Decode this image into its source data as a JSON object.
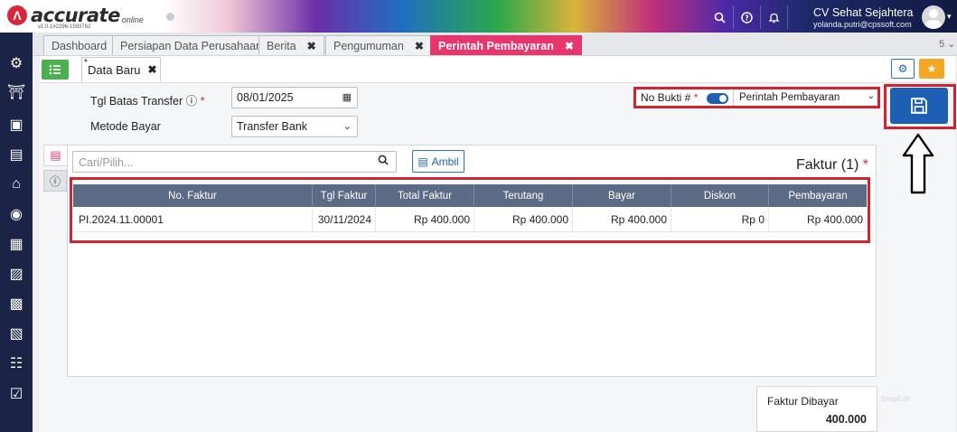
{
  "brand": {
    "name": "accurate",
    "cloud_label": "online",
    "version": "v1.0.1#2296-1593762"
  },
  "header": {
    "icons": [
      "search-icon",
      "help-icon",
      "bell-icon"
    ],
    "company_name": "CV Sehat Sejahtera",
    "user_email": "yolanda.putri@cpssoft.com"
  },
  "sidebar": {
    "icons": [
      "gear-icon",
      "bank-icon",
      "building-icon",
      "ledger-icon",
      "warehouse-icon",
      "money-bag-icon",
      "cart-icon",
      "delivery-icon",
      "factory-icon",
      "pos-icon",
      "report-icon",
      "check-icon"
    ]
  },
  "tabs": [
    {
      "label": "Dashboard",
      "closable": false
    },
    {
      "label": "Persiapan Data Perusahaan",
      "closable": false
    },
    {
      "label": "Berita",
      "closable": true
    },
    {
      "label": "Pengumuman",
      "closable": true
    },
    {
      "label": "Perintah Pembayaran",
      "closable": true,
      "active": true
    }
  ],
  "tab_count": "5",
  "subtab": {
    "label": "Data Baru",
    "modified_mark": "*"
  },
  "form": {
    "deadline_label": "Tgl Batas Transfer",
    "deadline_value": "08/01/2025",
    "method_label": "Metode Bayar",
    "method_value": "Transfer Bank",
    "required_mark": "*"
  },
  "no_bukti": {
    "label": "No Bukti #",
    "auto_on": true,
    "type_value": "Perintah Pembayaran"
  },
  "search": {
    "placeholder": "Cari/Pilih..."
  },
  "ambil_label": "Ambil",
  "faktur_title": "Faktur (1)",
  "table": {
    "columns": [
      "No. Faktur",
      "Tgl Faktur",
      "Total Faktur",
      "Terutang",
      "Bayar",
      "Diskon",
      "Pembayaran"
    ],
    "rows": [
      [
        "PI.2024.11.00001",
        "30/11/2024",
        "Rp 400.000",
        "Rp 400.000",
        "Rp 400.000",
        "Rp 0",
        "Rp 400.000"
      ]
    ]
  },
  "summary": {
    "label": "Faktur Dibayar",
    "value": "400.000"
  },
  "watermark": "SnapEdit",
  "colors": {
    "accent": "#e8356d",
    "primary": "#1d5fb3",
    "highlight": "#d3232f",
    "sidebar": "#1b2446"
  }
}
